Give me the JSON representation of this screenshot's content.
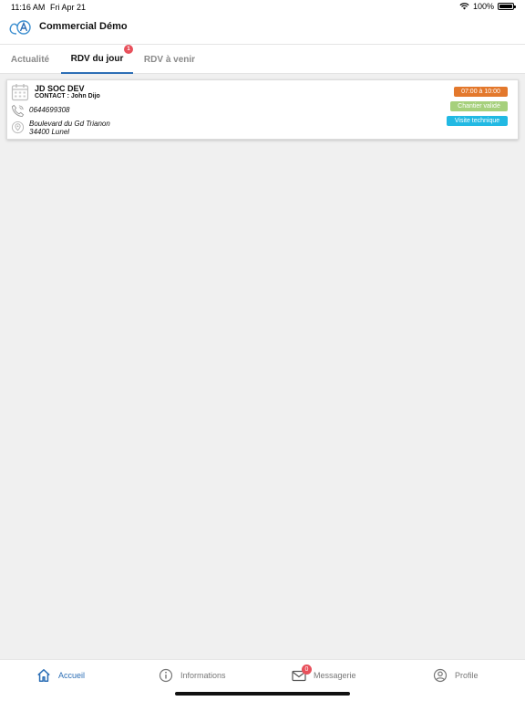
{
  "status_bar": {
    "time": "11:16 AM",
    "date": "Fri Apr 21",
    "battery": "100%"
  },
  "header": {
    "title": "Commercial Démo",
    "logo_icon": "logo-icon"
  },
  "tabs": [
    {
      "label": "Actualité",
      "active": false
    },
    {
      "label": "RDV du jour",
      "active": true,
      "badge": "1"
    },
    {
      "label": "RDV à venir",
      "active": false
    }
  ],
  "appointments": [
    {
      "company": "JD SOC DEV",
      "contact": "CONTACT : John Dijo",
      "phone": "0644699308",
      "address_line1": "Boulevard du Gd Trianon",
      "address_line2": "34400 Lunel",
      "time": "07:00 à 10:00",
      "status": "Chantier validé",
      "type": "Visite technique"
    }
  ],
  "bottom_nav": [
    {
      "label": "Accueil",
      "icon": "home-icon",
      "active": true
    },
    {
      "label": "Informations",
      "icon": "info-icon",
      "active": false
    },
    {
      "label": "Messagerie",
      "icon": "mail-icon",
      "active": false,
      "badge": "0"
    },
    {
      "label": "Profile",
      "icon": "profile-icon",
      "active": false
    }
  ],
  "colors": {
    "accent": "#2d6fb6",
    "time_badge": "#e3782c",
    "status_badge": "#a6d07c",
    "type_badge": "#22b9e3",
    "notification": "#e8505b"
  }
}
